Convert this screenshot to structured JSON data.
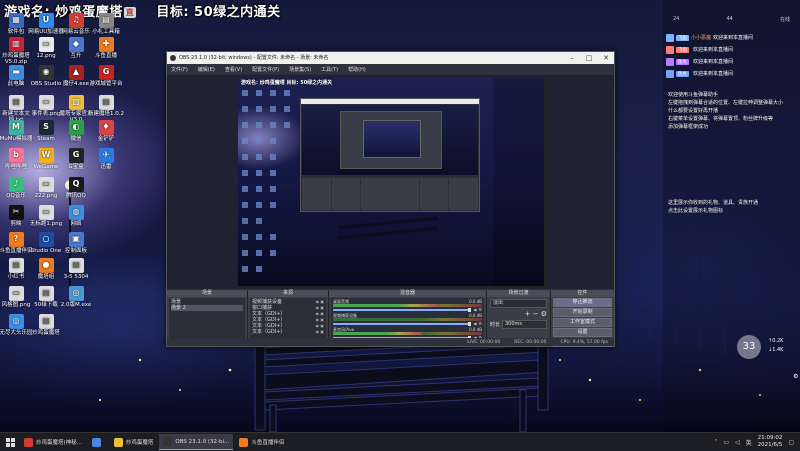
{
  "overlay": {
    "game_label": "游戏名:",
    "game_name": "炒鸡蛋魔塔",
    "live_badge": "直",
    "goal_label": "目标:",
    "goal_text": "50绿之内通关"
  },
  "desktop_icons": [
    {
      "label": "软件包",
      "color": "#3a6cc6",
      "glyph": "▦"
    },
    {
      "label": "网易UU加速器",
      "color": "#2d8cf0",
      "glyph": "U"
    },
    {
      "label": "网易云音乐",
      "color": "#d43c33",
      "glyph": "♫"
    },
    {
      "label": "小礼工具箱",
      "color": "#888",
      "glyph": "▤"
    },
    {
      "label": "炒鸡蛋魔塔V5.0.zip",
      "color": "#c23",
      "glyph": "▥"
    },
    {
      "label": "12.png",
      "color": "#eaeaea",
      "glyph": "▭"
    },
    {
      "label": "互升",
      "color": "#4a78d0",
      "glyph": "◆"
    },
    {
      "label": "斗鱼直播",
      "color": "#f07b1e",
      "glyph": "✚"
    },
    {
      "label": "此电脑",
      "color": "#3c8ee0",
      "glyph": "▬"
    },
    {
      "label": "OBS Studio",
      "color": "#333",
      "glyph": "◉"
    },
    {
      "label": "魔仔4.exe",
      "color": "#a22",
      "glyph": "▲"
    },
    {
      "label": "游戏城管平台",
      "color": "#c22",
      "glyph": "G"
    },
    {
      "label": "新建文本文档.txt",
      "color": "#ddd",
      "glyph": "▤"
    },
    {
      "label": "事件表.png",
      "color": "#ddd",
      "glyph": "▭"
    },
    {
      "label": "魔塔专家官方V3.0",
      "color": "#f0c030",
      "glyph": "▧"
    },
    {
      "label": "新建魔塔1.0.2",
      "color": "#ddd",
      "glyph": "▤"
    },
    {
      "label": "MuMu模拟器",
      "color": "#3fb5a0",
      "glyph": "M"
    },
    {
      "label": "Steam",
      "color": "#1b2838",
      "glyph": "S"
    },
    {
      "label": "微信",
      "color": "#2ba245",
      "glyph": "◐"
    },
    {
      "label": "金铲铲",
      "color": "#d44",
      "glyph": "♦"
    },
    {
      "label": "哔哩哔哩",
      "color": "#fb7299",
      "glyph": "b"
    },
    {
      "label": "WeGame",
      "color": "#f2b01e",
      "glyph": "W"
    },
    {
      "label": "G宝盒",
      "color": "#222",
      "glyph": "G"
    },
    {
      "label": "迅雷",
      "color": "#2a7ae2",
      "glyph": "✈"
    },
    {
      "label": "QQ音乐",
      "color": "#31c27c",
      "glyph": "♪"
    },
    {
      "label": "222.png",
      "color": "#ddd",
      "glyph": "▭"
    },
    {
      "label": "腾讯QQ",
      "color": "#1a1a1a",
      "glyph": "Q"
    },
    {
      "label": "剪映",
      "color": "#111",
      "glyph": "✂"
    },
    {
      "label": "无标题1.png",
      "color": "#ddd",
      "glyph": "▭"
    },
    {
      "label": "网络",
      "color": "#3c8ee0",
      "glyph": "◍"
    },
    {
      "label": "斗鱼直播伴侣",
      "color": "#f07b1e",
      "glyph": "?"
    },
    {
      "label": "Studio One",
      "color": "#1a4da3",
      "glyph": "○"
    },
    {
      "label": "控制面板",
      "color": "#4a7ad0",
      "glyph": "▣"
    },
    {
      "label": "小红书",
      "color": "#ddd",
      "glyph": "▤"
    },
    {
      "label": "魔塔组",
      "color": "#f07b1e",
      "glyph": "●"
    },
    {
      "label": "3-5 5304",
      "color": "#ddd",
      "glyph": "▤"
    },
    {
      "label": "风格图.png",
      "color": "#ddd",
      "glyph": "▭"
    },
    {
      "label": "50绿下载",
      "color": "#ddd",
      "glyph": "▤"
    },
    {
      "label": "2.0版M.exe",
      "color": "#4a9ad0",
      "glyph": "◎"
    },
    {
      "label": "无尽大头乐园",
      "color": "#3a8ee6",
      "glyph": "◎"
    },
    {
      "label": "炒鸡蛋魔塔",
      "color": "#ddd",
      "glyph": "▤"
    }
  ],
  "obs": {
    "title": "OBS 23.1.0 (32-bit, windows) - 配置文件: 未命名 - 场景: 未命名",
    "menu": [
      "文件(F)",
      "编辑(E)",
      "查看(V)",
      "配置文件(P)",
      "场景集(S)",
      "工具(T)",
      "帮助(H)"
    ],
    "nested_title": "游戏名: 炒鸡蛋魔塔 目标: 50绿之内通关",
    "docks": {
      "scenes": {
        "header": "场景",
        "items": [
          "场景",
          "场景 2"
        ]
      },
      "sources": {
        "header": "来源",
        "items": [
          "视频捕获设备",
          "窗口捕获",
          "文本（GDI+）",
          "文本（GDI+）",
          "文本（GDI+）",
          "文本（GDI+）"
        ]
      },
      "mixer": {
        "header": "混音器",
        "channels": [
          {
            "name": "桌面音频",
            "db": "0.0 dB",
            "level": 0.72
          },
          {
            "name": "视频捕获设备",
            "db": "0.0 dB",
            "level": 0.0
          },
          {
            "name": "麦克风/Aux",
            "db": "0.0 dB",
            "level": 0.6
          }
        ]
      },
      "transitions": {
        "header": "场景过渡",
        "type": "淡出",
        "duration_label": "时长",
        "duration": "300ms"
      },
      "controls": {
        "header": "控件",
        "buttons": [
          "停止推流",
          "开始录制",
          "工作室模式",
          "设置",
          "退出"
        ]
      }
    },
    "status": {
      "lost": "LIVE: 00:00:00",
      "rec": "REC: 00:00:00",
      "cpu": "CPU: 9.4%, 57.00 fps"
    }
  },
  "right_panel": {
    "counts": [
      "24",
      "44",
      "在线"
    ],
    "gift_rows": [
      {
        "badge": "飞鱼",
        "name": "小小恶魔",
        "text": "欢迎来到本直播间",
        "color": "#7ab6ff"
      },
      {
        "badge": "飞鱼",
        "name": "",
        "text": "欢迎来到本直播间",
        "color": "#ff7a7a"
      },
      {
        "badge": "鱼丸",
        "name": "",
        "text": "欢迎来到本直播间",
        "color": "#b57aff"
      },
      {
        "badge": "鱼丸",
        "name": "",
        "text": "欢迎来到本直播间",
        "color": "#7aa0ff"
      }
    ],
    "messages": [
      "欢迎使用斗鱼弹幕助手",
      "左键拖拽到弹幕合适的位置、左键拉伸调整弹幕大小",
      "什么都要设置好再开播",
      "右键菜单设置弹幕、将弹幕置顶、粉丝牌升级等",
      "添加弹幕框架成功",
      "这里展示你收到的礼物、道具、贵族开通",
      "点击此设置展示礼物图标"
    ],
    "counter": "33",
    "counter_side_1": "↑0.2K",
    "counter_side_2": "↓1.4K"
  },
  "taskbar": {
    "items": [
      {
        "label": "炒鸡蛋魔塔(神秘...",
        "color": "#d43c33"
      },
      {
        "label": "",
        "color": "#4a86e8"
      },
      {
        "label": "炒鸡蛋魔塔",
        "color": "#f0c030"
      },
      {
        "label": "OBS 23.1.0 (32-bi...",
        "color": "#333"
      },
      {
        "label": "斗鱼直播伴侣",
        "color": "#f07b1e"
      }
    ],
    "tray": "英",
    "time": "21:09:02",
    "date": "2021/6/5"
  }
}
